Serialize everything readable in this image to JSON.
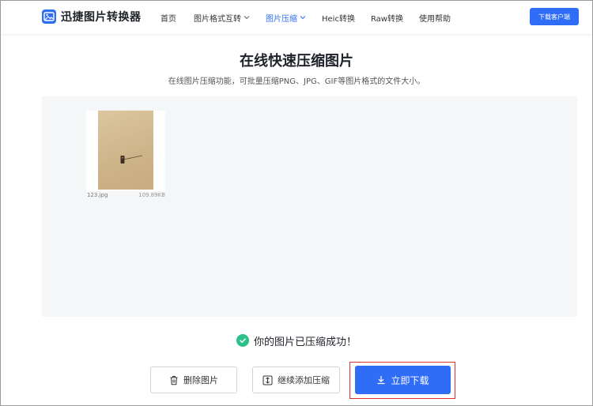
{
  "header": {
    "app_name": "迅捷图片转换器",
    "nav": [
      {
        "label": "首页",
        "active": false,
        "dropdown": false
      },
      {
        "label": "图片格式互转",
        "active": false,
        "dropdown": true
      },
      {
        "label": "图片压缩",
        "active": true,
        "dropdown": true
      },
      {
        "label": "Heic转换",
        "active": false,
        "dropdown": false
      },
      {
        "label": "Raw转换",
        "active": false,
        "dropdown": false
      },
      {
        "label": "使用帮助",
        "active": false,
        "dropdown": false
      }
    ],
    "client_button": "下载客户端"
  },
  "main": {
    "title": "在线快速压缩图片",
    "subtitle": "在线图片压缩功能，可批量压缩PNG、JPG、GIF等图片格式的文件大小。",
    "files": [
      {
        "name": "123.jpg",
        "size": "109.89KB"
      }
    ],
    "success_message": "你的图片已压缩成功！",
    "buttons": {
      "delete": "删除图片",
      "add_more": "继续添加压缩",
      "download": "立即下载"
    }
  },
  "colors": {
    "accent": "#2f6df6",
    "success": "#29c189",
    "highlight": "#e0312d"
  },
  "icons": {
    "logo": "image-logo-icon",
    "delete": "trash-icon",
    "add": "add-compress-icon",
    "download": "download-icon",
    "success": "check-circle-icon"
  }
}
